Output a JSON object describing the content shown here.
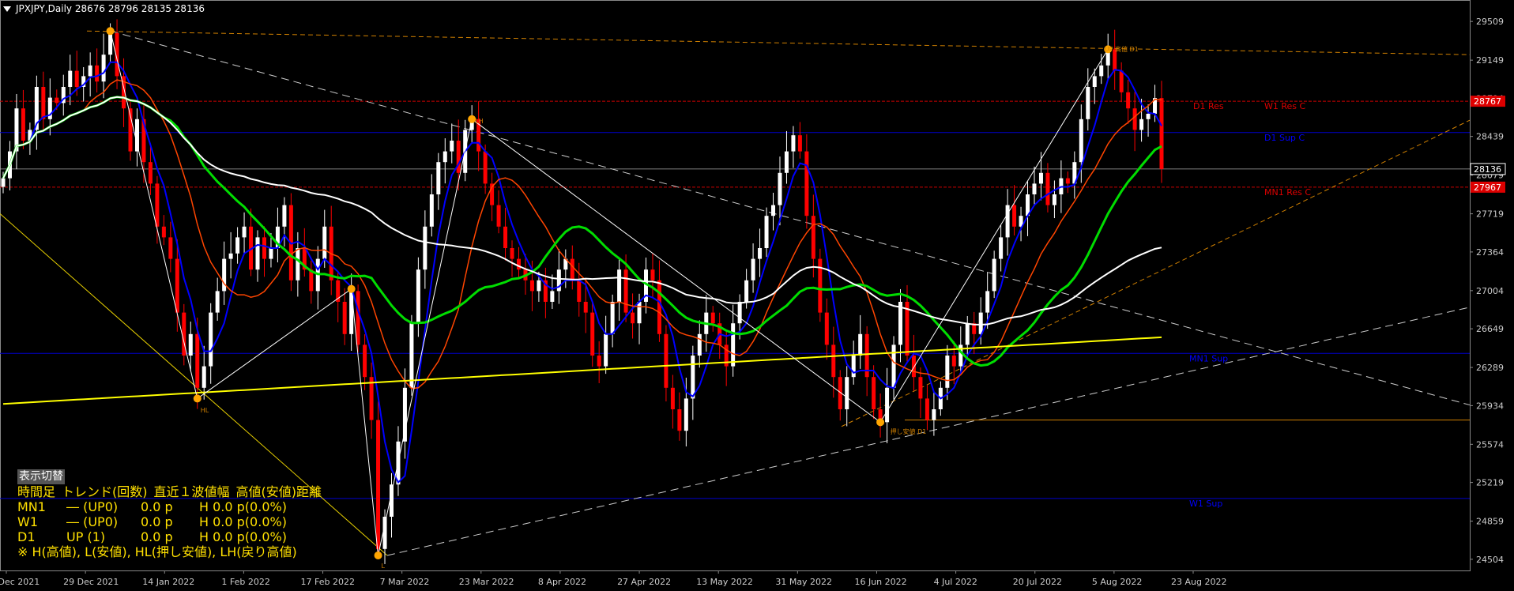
{
  "header": {
    "symbol_label": "JPXJPY,Daily  28676 28796 28135 28136"
  },
  "panel": {
    "toggle_label": "表示切替",
    "headers": [
      "時間足",
      "トレンド(回数)",
      "直近１波値幅",
      "高値(安値)距離"
    ],
    "rows": [
      [
        "MN1",
        "―  (UP0)",
        "0.0 p",
        "H 0.0 p(0.0%)"
      ],
      [
        "W1",
        "―  (UP0)",
        "0.0 p",
        "H 0.0 p(0.0%)"
      ],
      [
        "D1",
        "UP (1)",
        "0.0 p",
        "H 0.0 p(0.0%)"
      ]
    ],
    "note": "※ H(高値), L(安値), HL(押し安値), LH(戻り高値)"
  },
  "chart_data": {
    "type": "candlestick",
    "symbol": "JPXJPY",
    "timeframe": "Daily",
    "last_price": 28136,
    "ylim": [
      24400,
      29650
    ],
    "y_ticks": [
      29509,
      29149,
      28794,
      28439,
      28079,
      27719,
      27364,
      27004,
      26649,
      26289,
      25934,
      25574,
      25219,
      24859,
      24504
    ],
    "x_ticks": [
      "20 Dec 2021",
      "29 Dec 2021",
      "14 Jan 2022",
      "1 Feb 2022",
      "17 Feb 2022",
      "7 Mar 2022",
      "23 Mar 2022",
      "8 Apr 2022",
      "27 Apr 2022",
      "13 May 2022",
      "31 May 2022",
      "16 Jun 2022",
      "4 Jul 2022",
      "20 Jul 2022",
      "5 Aug 2022",
      "23 Aug 2022"
    ],
    "price_tags": [
      {
        "value": 28767,
        "color": "#dd0000",
        "text": "28767"
      },
      {
        "value": 28136,
        "color": "#000000",
        "text": "28136"
      },
      {
        "value": 27967,
        "color": "#dd0000",
        "text": "27967"
      }
    ],
    "levels": [
      {
        "value": 28767,
        "color": "#cc0000",
        "labels": [
          "D1 Res",
          "W1 Res C"
        ]
      },
      {
        "value": 28475,
        "color": "#0000cc",
        "labels": [
          "D1 Sup C"
        ]
      },
      {
        "value": 27967,
        "color": "#cc0000",
        "labels": [
          "MN1 Res C"
        ]
      },
      {
        "value": 26420,
        "color": "#0000cc",
        "labels": [
          "MN1 Sup"
        ]
      },
      {
        "value": 25070,
        "color": "#0000cc",
        "labels": [
          "W1 Sup"
        ]
      }
    ],
    "swing_points": [
      {
        "index": 16,
        "price": 29420
      },
      {
        "index": 29,
        "price": 26000
      },
      {
        "index": 52,
        "price": 27020
      },
      {
        "index": 56,
        "price": 24540
      },
      {
        "index": 70,
        "price": 28600
      },
      {
        "index": 131,
        "price": 25780
      },
      {
        "index": 165,
        "price": 29250
      }
    ],
    "small_labels": [
      {
        "index": 29,
        "price": 25930,
        "text": "HL"
      },
      {
        "index": 70,
        "price": 28620,
        "text": "LH"
      },
      {
        "index": 56,
        "price": 24480,
        "text": "L"
      },
      {
        "index": 132,
        "price": 25730,
        "text": "押し安値 D1"
      },
      {
        "index": 164,
        "price": 29290,
        "text": "UP 高値 D1"
      }
    ],
    "ohlc_seed": [
      28050,
      28300,
      28700,
      28400,
      28500,
      28900,
      28600,
      28800,
      28750,
      28900,
      29050,
      28900,
      29000,
      29100,
      28950,
      29200,
      29400,
      29000,
      28700,
      28300,
      28600,
      28200,
      28000,
      27600,
      27500,
      27300,
      26800,
      26400,
      26600,
      26100,
      26300,
      26800,
      27000,
      27300,
      27350,
      27500,
      27600,
      27200,
      27500,
      27300,
      27400,
      27600,
      27800,
      27100,
      27400,
      27200,
      27000,
      27300,
      27600,
      27100,
      26900,
      26600,
      27000,
      26500,
      26200,
      25800,
      24600,
      24900,
      25200,
      25600,
      26100,
      26700,
      27200,
      27600,
      27900,
      28200,
      28300,
      28400,
      28100,
      28500,
      28600,
      28300,
      28000,
      27800,
      27600,
      27400,
      27300,
      27200,
      27100,
      27000,
      27100,
      26900,
      27000,
      27200,
      27300,
      27100,
      26900,
      26800,
      26400,
      26300,
      26600,
      26900,
      27200,
      26800,
      26700,
      26900,
      27200,
      27100,
      26600,
      26100,
      25900,
      25700,
      26000,
      26400,
      26600,
      26800,
      26700,
      26500,
      26300,
      26700,
      26900,
      27100,
      27300,
      27400,
      27700,
      27800,
      28100,
      28300,
      28450,
      28300,
      27700,
      27300,
      26800,
      26500,
      26200,
      25900,
      26200,
      26400,
      26600,
      26200,
      25900,
      25780,
      26100,
      26500,
      26900,
      26400,
      26200,
      26000,
      25800,
      25900,
      26100,
      26400,
      26300,
      26500,
      26700,
      26600,
      26800,
      27000,
      27300,
      27500,
      27800,
      27600,
      27700,
      27900,
      28000,
      28100,
      27800,
      27900,
      28050,
      28000,
      28200,
      28600,
      28900,
      29000,
      29100,
      29250,
      29050,
      28850,
      28700,
      28500,
      28600,
      28650,
      28796,
      28136
    ]
  },
  "colors": {
    "bull": "#ffffff",
    "bear": "#ff0000",
    "ma_blue": "#0000ff",
    "ma_orange": "#ff4500",
    "ma_green": "#00dd00",
    "ma_white": "#ffffff",
    "ma_yellow": "#ffff00",
    "grid": "#3a3a3a"
  }
}
